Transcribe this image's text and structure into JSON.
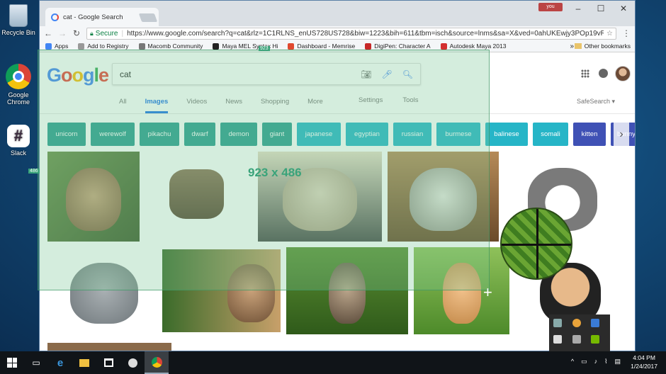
{
  "desktop": {
    "icons": [
      {
        "label": "Recycle Bin"
      },
      {
        "label": "Google Chrome"
      },
      {
        "label": "Slack"
      }
    ]
  },
  "browser": {
    "tab_title": "cat - Google Search",
    "profile_badge": "you",
    "secure_label": "Secure",
    "url": "https://www.google.com/search?q=cat&rlz=1C1RLNS_enUS728US728&biw=1223&bih=611&tbm=isch&source=lnms&sa=X&ved=0ahUKEwjy3POp19vRAhWI",
    "bookmarks": [
      {
        "label": "Apps",
        "color": "#4285f4"
      },
      {
        "label": "Add to Registry",
        "color": "#999999"
      },
      {
        "label": "Macomb Community",
        "color": "#777777"
      },
      {
        "label": "Maya MEL Syntax Hi",
        "color": "#222222"
      },
      {
        "label": "Dashboard - Memrise",
        "color": "#e0492f"
      },
      {
        "label": "DigiPen: Character A",
        "color": "#c62828"
      },
      {
        "label": "Autodesk Maya 2013",
        "color": "#d32f2f"
      }
    ],
    "other_bookmarks": "Other bookmarks"
  },
  "google": {
    "logo": "Google",
    "query": "cat",
    "tabs": [
      "All",
      "Images",
      "Videos",
      "News",
      "Shopping",
      "More"
    ],
    "active_tab": "Images",
    "right_tabs": [
      "Settings",
      "Tools"
    ],
    "safesearch": "SafeSearch ▾",
    "chips": [
      {
        "label": "unicorn",
        "color": "#2a9d8f",
        "width": 54
      },
      {
        "label": "werewolf",
        "color": "#2a9d8f",
        "width": 62
      },
      {
        "label": "pikachu",
        "color": "#2a9d8f",
        "width": 56
      },
      {
        "label": "dwarf",
        "color": "#2a9d8f",
        "width": 44
      },
      {
        "label": "demon",
        "color": "#2a9d8f",
        "width": 52
      },
      {
        "label": "giant",
        "color": "#2a9d8f",
        "width": 42
      },
      {
        "label": "japanese",
        "color": "#26b5c7",
        "width": 62
      },
      {
        "label": "egyptian",
        "color": "#26b5c7",
        "width": 60
      },
      {
        "label": "russian",
        "color": "#26b5c7",
        "width": 54
      },
      {
        "label": "burmese",
        "color": "#26b5c7",
        "width": 62
      },
      {
        "label": "balinese",
        "color": "#26b5c7",
        "width": 60
      },
      {
        "label": "somali",
        "color": "#26b5c7",
        "width": 50
      },
      {
        "label": "kitten",
        "color": "#3f51b5",
        "width": 46
      },
      {
        "label": "bunny",
        "color": "#3f51b5",
        "width": 44
      }
    ]
  },
  "overlay": {
    "size_text": "923 x 486",
    "width_tag": "923",
    "height_tag": "486"
  },
  "taskbar": {
    "time": "4:04 PM",
    "date": "1/24/2017"
  }
}
